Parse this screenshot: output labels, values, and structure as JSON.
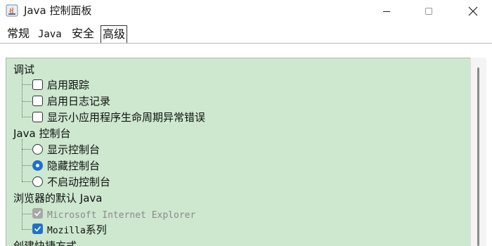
{
  "window": {
    "title": "Java 控制面板"
  },
  "tabs": [
    {
      "label": "常规"
    },
    {
      "label": "Java"
    },
    {
      "label": "安全"
    },
    {
      "label": "高级"
    }
  ],
  "tree": {
    "debug": {
      "heading": "调试",
      "items": [
        {
          "label": "启用跟踪",
          "checked": false
        },
        {
          "label": "启用日志记录",
          "checked": false
        },
        {
          "label": "显示小应用程序生命周期异常错误",
          "checked": false
        }
      ]
    },
    "console": {
      "heading": "Java 控制台",
      "options": [
        {
          "label": "显示控制台",
          "selected": false
        },
        {
          "label": "隐藏控制台",
          "selected": true
        },
        {
          "label": "不启动控制台",
          "selected": false
        }
      ]
    },
    "browser": {
      "heading": "浏览器的默认 Java",
      "items": [
        {
          "label": "Microsoft Internet Explorer",
          "checked": true,
          "enabled": false
        },
        {
          "label_mono": "Mozilla",
          "label_cn": " 系列",
          "checked": true,
          "enabled": true
        }
      ]
    },
    "shortcut": {
      "heading": "创建快捷方式"
    }
  },
  "colors": {
    "panel_bg": "#cde8cf",
    "accent": "#1f6fd1"
  }
}
